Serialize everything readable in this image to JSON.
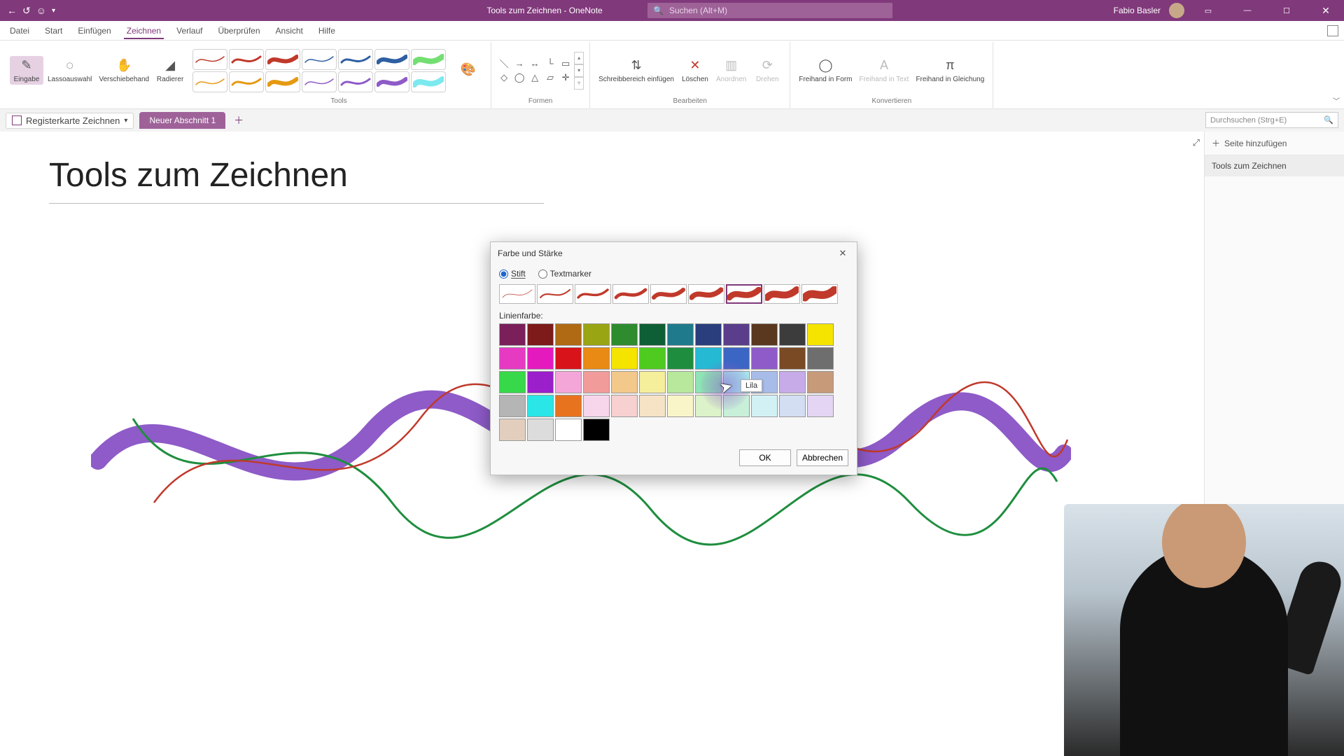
{
  "titlebar": {
    "app_title": "Tools zum Zeichnen  -  OneNote",
    "search_placeholder": "Suchen (Alt+M)",
    "user_name": "Fabio Basler"
  },
  "menu": {
    "tabs": [
      "Datei",
      "Start",
      "Einfügen",
      "Zeichnen",
      "Verlauf",
      "Überprüfen",
      "Ansicht",
      "Hilfe"
    ],
    "active_index": 3
  },
  "ribbon": {
    "groups": {
      "select": {
        "eingabe": "Eingabe",
        "lasso": "Lassoauswahl",
        "pan": "Verschiebehand",
        "eraser": "Radierer"
      },
      "tools_label": "Tools",
      "color_thickness": "Farbe und Stärke",
      "shapes_label": "Formen",
      "edit": {
        "insert_space": "Schreibbereich einfügen",
        "delete": "Löschen",
        "arrange": "Anordnen",
        "rotate": "Drehen",
        "label": "Bearbeiten"
      },
      "convert": {
        "to_shape": "Freihand in Form",
        "to_text": "Freihand in Text",
        "to_math": "Freihand in Gleichung",
        "label": "Konvertieren"
      }
    },
    "pens": [
      {
        "color": "#C0392B",
        "w": 1.5
      },
      {
        "color": "#C0392B",
        "w": 3
      },
      {
        "color": "#C0392B",
        "w": 6
      },
      {
        "color": "#2E5FA3",
        "w": 1.5
      },
      {
        "color": "#2E5FA3",
        "w": 3
      },
      {
        "color": "#2E5FA3",
        "w": 6
      },
      {
        "color": "#38D236",
        "w": 8,
        "hl": true
      },
      {
        "color": "#E59A12",
        "w": 1.5
      },
      {
        "color": "#E59A12",
        "w": 3
      },
      {
        "color": "#E59A12",
        "w": 6
      },
      {
        "color": "#8E5BC8",
        "w": 1.5
      },
      {
        "color": "#8E5BC8",
        "w": 3
      },
      {
        "color": "#8E5BC8",
        "w": 6
      },
      {
        "color": "#45E0E8",
        "w": 8,
        "hl": true
      }
    ]
  },
  "notebook": {
    "nb_label": "Registerkarte Zeichnen",
    "section": "Neuer Abschnitt 1",
    "search_placeholder": "Durchsuchen (Strg+E)",
    "add_page": "Seite hinzufügen",
    "page_item": "Tools zum Zeichnen"
  },
  "page": {
    "title": "Tools zum Zeichnen"
  },
  "dialog": {
    "title": "Farbe und Stärke",
    "radio_pen": "Stift",
    "radio_marker": "Textmarker",
    "line_color_label": "Linienfarbe:",
    "ok": "OK",
    "cancel": "Abbrechen",
    "tooltip": "Lila",
    "selected_thickness_index": 6,
    "colors": [
      "#7A1F5A",
      "#7D1A1A",
      "#B06A13",
      "#9AA514",
      "#2E8B2E",
      "#0F5F36",
      "#1F7A8C",
      "#2A3E7D",
      "#5A3E8C",
      "#5A381F",
      "#3C3C3C",
      "#F4E400",
      "#E63AC3",
      "#E41ABF",
      "#D8131A",
      "#E88A13",
      "#F4E400",
      "#4FCB1F",
      "#1E8E3E",
      "#25B9D3",
      "#3C66C4",
      "#8E5BC8",
      "#7A4A25",
      "#6E6E6E",
      "#37D84A",
      "#9B1FCB",
      "#F5A6D8",
      "#F29B9B",
      "#F3C88B",
      "#F5EE9B",
      "#B7E89B",
      "#8FE3B4",
      "#A6E6EE",
      "#A7BCE8",
      "#C7ABE8",
      "#C79A7A",
      "#B5B5B5",
      "#2AE6E6",
      "#E8731F",
      "#F7D6EC",
      "#F7D0D0",
      "#F6E3C6",
      "#F9F5C9",
      "#DCF2C9",
      "#C8F0D8",
      "#D2F1F5",
      "#D3DEF3",
      "#E3D5F3",
      "#E3CEBE",
      "#DCDCDC",
      "#FFFFFF",
      "#000000"
    ]
  }
}
